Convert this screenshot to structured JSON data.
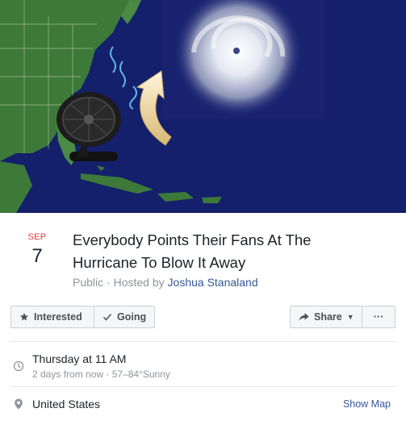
{
  "event": {
    "month": "SEP",
    "day": "7",
    "title": "Everybody Points Their Fans At The Hurricane To Blow It Away",
    "privacy": "Public",
    "host_prefix": "Hosted by",
    "host_name": "Joshua Stanaland"
  },
  "actions": {
    "interested_label": "Interested",
    "going_label": "Going",
    "share_label": "Share",
    "more_label": "···"
  },
  "details": {
    "time_main": "Thursday at 11 AM",
    "time_sub": "2 days from now · 57–84°Sunny",
    "location": "United States",
    "show_map_label": "Show Map"
  },
  "icons": {
    "interested": "star-icon",
    "going": "check-icon",
    "share": "share-arrow-icon",
    "time": "clock-icon",
    "location": "map-pin-icon"
  },
  "colors": {
    "ocean": "#14206b",
    "land": "#3d7a3a",
    "month_red": "#e0393e",
    "link_blue": "#365899",
    "muted": "#90949c"
  }
}
